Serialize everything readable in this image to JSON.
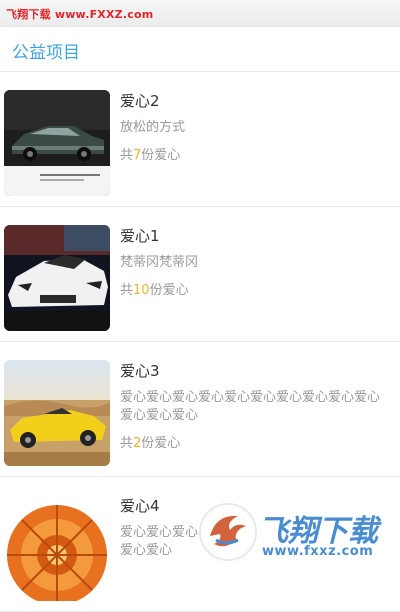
{
  "watermark_top": "飞翔下载 www.FXXZ.com",
  "section": {
    "title": "公益项目"
  },
  "items": [
    {
      "title": "爱心2",
      "desc": "放松的方式",
      "count_prefix": "共",
      "count": "7",
      "count_suffix": "份爱心",
      "image": "black-classic-car-photo"
    },
    {
      "title": "爱心1",
      "desc": "梵蒂冈梵蒂冈",
      "count_prefix": "共",
      "count": "10",
      "count_suffix": "份爱心",
      "image": "white-sports-car-photo"
    },
    {
      "title": "爱心3",
      "desc": "爱心爱心爱心爱心爱心爱心爱心爱心爱心爱心爱心爱心爱心",
      "count_prefix": "共",
      "count": "2",
      "count_suffix": "份爱心",
      "image": "yellow-convertible-photo"
    },
    {
      "title": "爱心4",
      "desc": "爱心爱心爱心爱心爱心",
      "image": "orange-wheel-photo"
    }
  ],
  "watermark_logo": {
    "text": "飞翔下载",
    "url": "www.fxxz.com"
  },
  "colors": {
    "header_title": "#41a4d9",
    "count_number": "#f2b32b",
    "watermark_red": "#e0262b",
    "logo_blue": "#2b78c8"
  }
}
